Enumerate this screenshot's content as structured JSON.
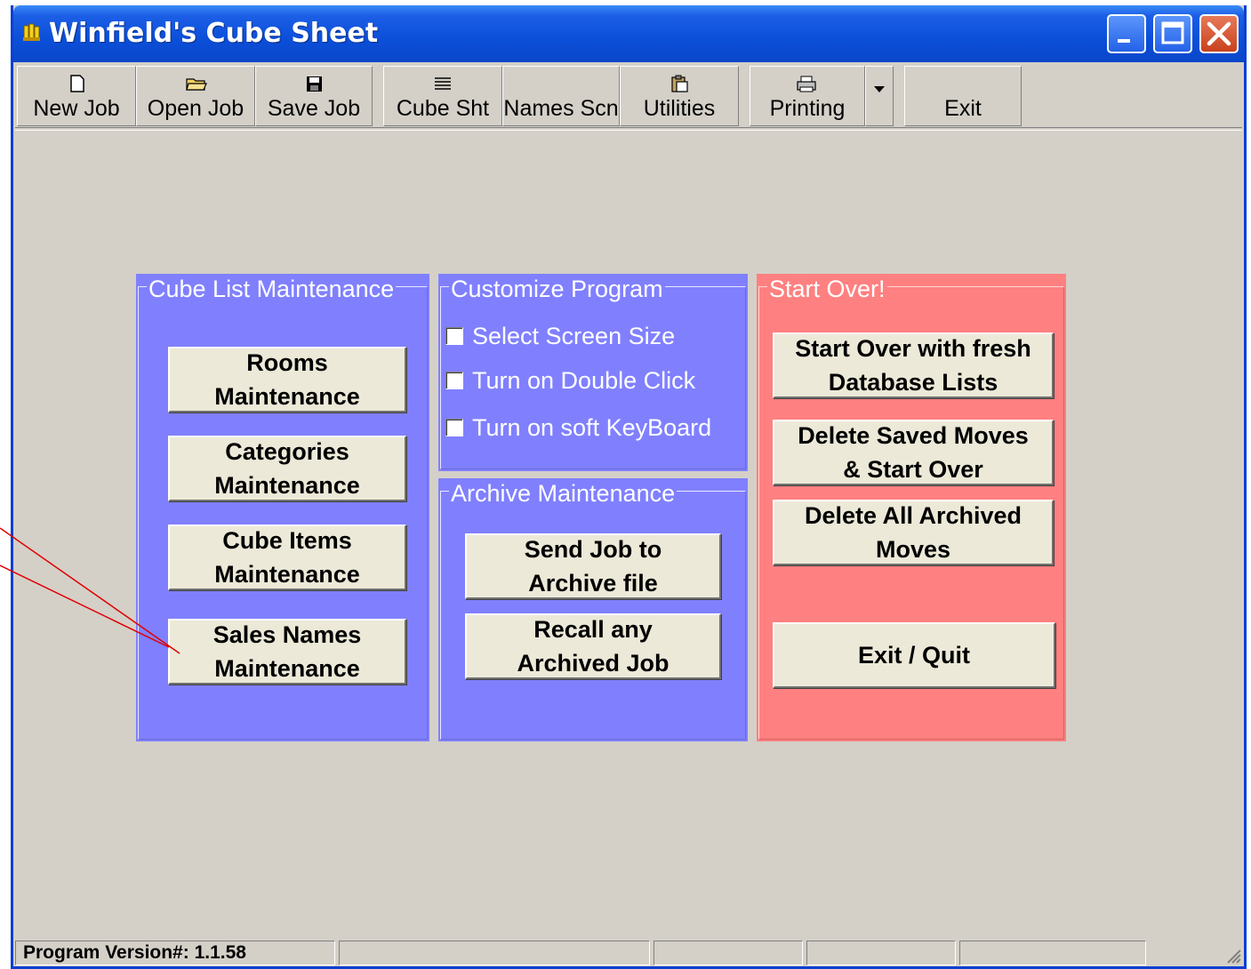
{
  "window": {
    "title": "Winfield's Cube Sheet"
  },
  "toolbar": {
    "new_job": "New Job",
    "open_job": "Open Job",
    "save_job": "Save Job",
    "cube_sht": "Cube Sht",
    "names_scn": "Names Scn",
    "utilities": "Utilities",
    "printing": "Printing",
    "exit": "Exit"
  },
  "cube_list": {
    "title": "Cube List Maintenance",
    "rooms": [
      "Rooms",
      "Maintenance"
    ],
    "categories": [
      "Categories",
      "Maintenance"
    ],
    "cube_items": [
      "Cube Items",
      "Maintenance"
    ],
    "sales_names": [
      "Sales Names",
      "Maintenance"
    ]
  },
  "customize": {
    "title": "Customize Program",
    "select_screen_size": "Select Screen Size",
    "double_click": "Turn on Double Click",
    "soft_keyboard": "Turn on soft KeyBoard"
  },
  "archive": {
    "title": "Archive Maintenance",
    "send_job": [
      "Send Job to",
      "Archive file"
    ],
    "recall_job": [
      "Recall any",
      "Archived Job"
    ]
  },
  "start_over": {
    "title": "Start Over!",
    "fresh_lists": [
      "Start Over with fresh",
      "Database Lists"
    ],
    "delete_saved": [
      "Delete Saved Moves",
      "& Start Over"
    ],
    "delete_archived": [
      "Delete All Archived",
      "Moves"
    ],
    "exit_quit": "Exit / Quit"
  },
  "statusbar": {
    "version": "Program Version#: 1.1.58"
  },
  "colors": {
    "panel_blue": "#8080ff",
    "panel_red": "#ff8080",
    "title_blue": "#0b4fd9",
    "annotation_line": "#e00000"
  },
  "icons": [
    "new-document-icon",
    "open-folder-icon",
    "save-disk-icon",
    "cube-sheet-icon",
    "utilities-clipboard-icon",
    "printer-icon",
    "dropdown-arrow-icon"
  ]
}
